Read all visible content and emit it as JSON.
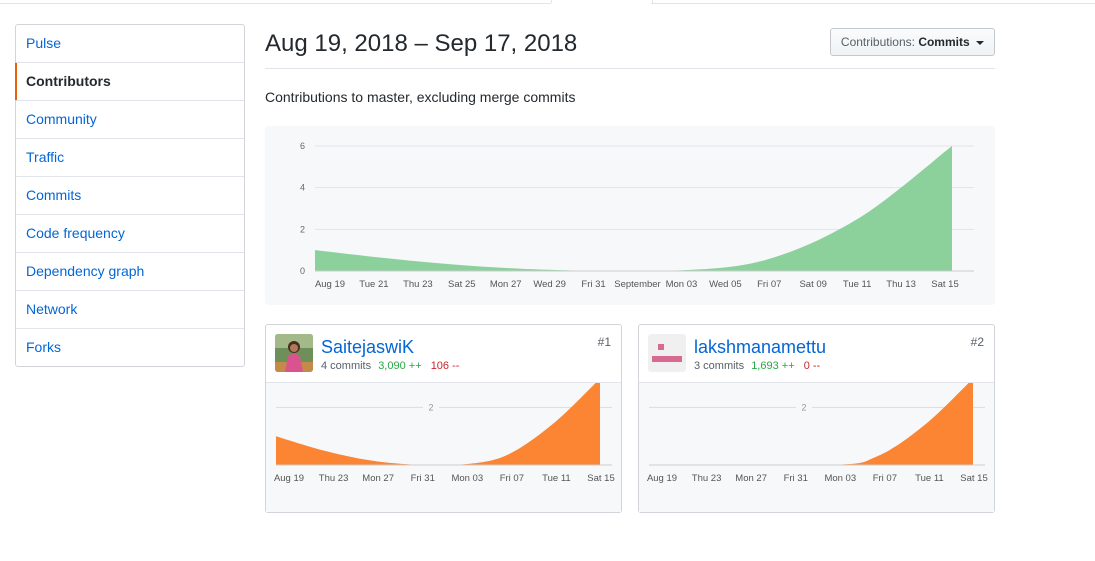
{
  "sidebar": {
    "items": [
      {
        "label": "Pulse"
      },
      {
        "label": "Contributors"
      },
      {
        "label": "Community"
      },
      {
        "label": "Traffic"
      },
      {
        "label": "Commits"
      },
      {
        "label": "Code frequency"
      },
      {
        "label": "Dependency graph"
      },
      {
        "label": "Network"
      },
      {
        "label": "Forks"
      }
    ],
    "selected": "Contributors"
  },
  "header": {
    "date_range": "Aug 19, 2018 – Sep 17, 2018",
    "dropdown_prefix": "Contributions:",
    "dropdown_value": "Commits"
  },
  "subtitle": "Contributions to master, excluding merge commits",
  "colors": {
    "main_area": "#8cd09c",
    "contributor_area": "#fb8532",
    "link": "#0366d6",
    "additions": "#28a745",
    "deletions": "#cb2431"
  },
  "chart_data": [
    {
      "type": "area",
      "x_tick_labels": [
        "Aug 19",
        "Tue 21",
        "Thu 23",
        "Sat 25",
        "Mon 27",
        "Wed 29",
        "Fri 31",
        "September",
        "Mon 03",
        "Wed 05",
        "Fri 07",
        "Sat 09",
        "Tue 11",
        "Thu 13",
        "Sat 15"
      ],
      "y_ticks": [
        0,
        2,
        4,
        6
      ],
      "ylim": [
        0,
        6
      ],
      "x_start": "2018-08-19",
      "x_end": "2018-09-15",
      "curve": [
        {
          "x": "2018-08-19",
          "y": 1
        },
        {
          "x": "2018-08-23",
          "y": 0.5
        },
        {
          "x": "2018-08-27",
          "y": 0.15
        },
        {
          "x": "2018-08-31",
          "y": 0
        },
        {
          "x": "2018-09-03",
          "y": 0
        },
        {
          "x": "2018-09-07",
          "y": 0.5
        },
        {
          "x": "2018-09-11",
          "y": 2.5
        },
        {
          "x": "2018-09-15",
          "y": 6
        }
      ],
      "grid": true
    },
    {
      "type": "area",
      "contributor": "SaitejaswiK",
      "x_tick_labels": [
        "Aug 19",
        "Thu 23",
        "Mon 27",
        "Fri 31",
        "Mon 03",
        "Fri 07",
        "Tue 11",
        "Sat 15"
      ],
      "y_ticks": [
        2
      ],
      "ylim": [
        0,
        2.5
      ],
      "x_start": "2018-08-19",
      "x_end": "2018-09-15",
      "curve": [
        {
          "x": "2018-08-19",
          "y": 1
        },
        {
          "x": "2018-08-23",
          "y": 0.5
        },
        {
          "x": "2018-08-27",
          "y": 0.15
        },
        {
          "x": "2018-08-31",
          "y": 0
        },
        {
          "x": "2018-09-03",
          "y": 0
        },
        {
          "x": "2018-09-07",
          "y": 0.3
        },
        {
          "x": "2018-09-11",
          "y": 1.4
        },
        {
          "x": "2018-09-15",
          "y": 3
        }
      ]
    },
    {
      "type": "area",
      "contributor": "lakshmanamettu",
      "x_tick_labels": [
        "Aug 19",
        "Thu 23",
        "Mon 27",
        "Fri 31",
        "Mon 03",
        "Fri 07",
        "Tue 11",
        "Sat 15"
      ],
      "y_ticks": [
        2
      ],
      "ylim": [
        0,
        2.5
      ],
      "x_start": "2018-08-19",
      "x_end": "2018-09-15",
      "curve": [
        {
          "x": "2018-08-19",
          "y": 0
        },
        {
          "x": "2018-09-03",
          "y": 0
        },
        {
          "x": "2018-09-07",
          "y": 0.3
        },
        {
          "x": "2018-09-11",
          "y": 1.4
        },
        {
          "x": "2018-09-15",
          "y": 3
        }
      ]
    }
  ],
  "contributors": [
    {
      "name": "SaitejaswiK",
      "commits": "4 commits",
      "additions": "3,090 ++",
      "deletions": "106 --",
      "rank": "#1"
    },
    {
      "name": "lakshmanamettu",
      "commits": "3 commits",
      "additions": "1,693 ++",
      "deletions": "0 --",
      "rank": "#2"
    }
  ]
}
